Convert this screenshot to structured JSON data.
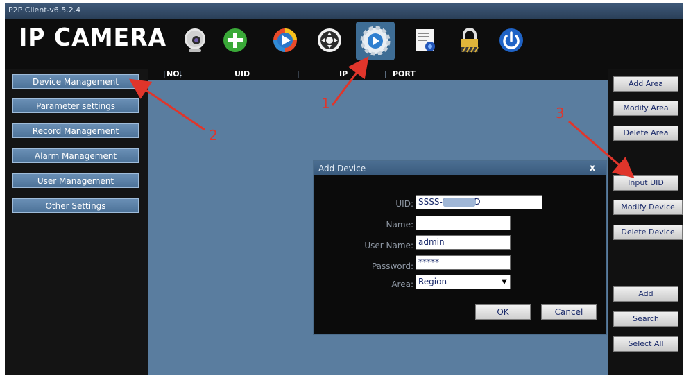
{
  "window": {
    "title": "P2P Client-v6.5.2.4"
  },
  "logo": {
    "text": "IP CAMERA"
  },
  "toolbar": {
    "icons": [
      "webcam-icon",
      "add-icon",
      "playback-icon",
      "ptz-icon",
      "settings-icon",
      "record-icon",
      "lock-icon",
      "power-icon"
    ],
    "selected": "settings-icon"
  },
  "sidebar": {
    "items": [
      {
        "label": "Device Management"
      },
      {
        "label": "Parameter settings"
      },
      {
        "label": "Record Management"
      },
      {
        "label": "Alarm Management"
      },
      {
        "label": "User Management"
      },
      {
        "label": "Other Settings"
      }
    ]
  },
  "table": {
    "columns": [
      "NO.",
      "UID",
      "IP",
      "PORT"
    ]
  },
  "right_panel": {
    "buttons": [
      "Add Area",
      "Modify Area",
      "Delete Area",
      "Input UID",
      "Modify Device",
      "Delete Device",
      "Add",
      "Search",
      "Select All"
    ]
  },
  "dialog": {
    "title": "Add Device",
    "close": "x",
    "fields": {
      "uid": {
        "label": "UID:",
        "value": "SSSS-S         CBDBD"
      },
      "name": {
        "label": "Name:",
        "value": ""
      },
      "user_name": {
        "label": "User Name:",
        "value": "admin"
      },
      "password": {
        "label": "Password:",
        "value": "*****"
      },
      "area": {
        "label": "Area:",
        "value": "Region"
      }
    },
    "ok": "OK",
    "cancel": "Cancel"
  },
  "annotations": [
    "1",
    "2",
    "3"
  ],
  "colors": {
    "annotation": "#e0352b",
    "accent": "#5a7d9f"
  }
}
